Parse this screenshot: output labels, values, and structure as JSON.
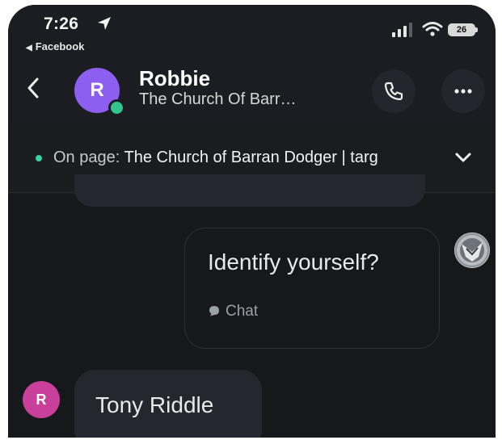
{
  "status_bar": {
    "time": "7:26",
    "back_app": "Facebook",
    "battery": "26"
  },
  "header": {
    "avatar_letter": "R",
    "contact_name": "Robbie",
    "contact_subtitle": "The Church Of Barr…"
  },
  "page_context": {
    "prefix": "On page: ",
    "title": "The Church of Barran Dodger | targ"
  },
  "messages": {
    "outgoing": {
      "text": "Identify yourself?",
      "tag": "Chat"
    },
    "incoming": {
      "avatar_letter": "R",
      "text": "Tony Riddle"
    }
  },
  "colors": {
    "background": "#16181c",
    "avatar_purple": "#8e5ef0",
    "avatar_pink": "#c8409a",
    "online_green": "#33c48d"
  }
}
